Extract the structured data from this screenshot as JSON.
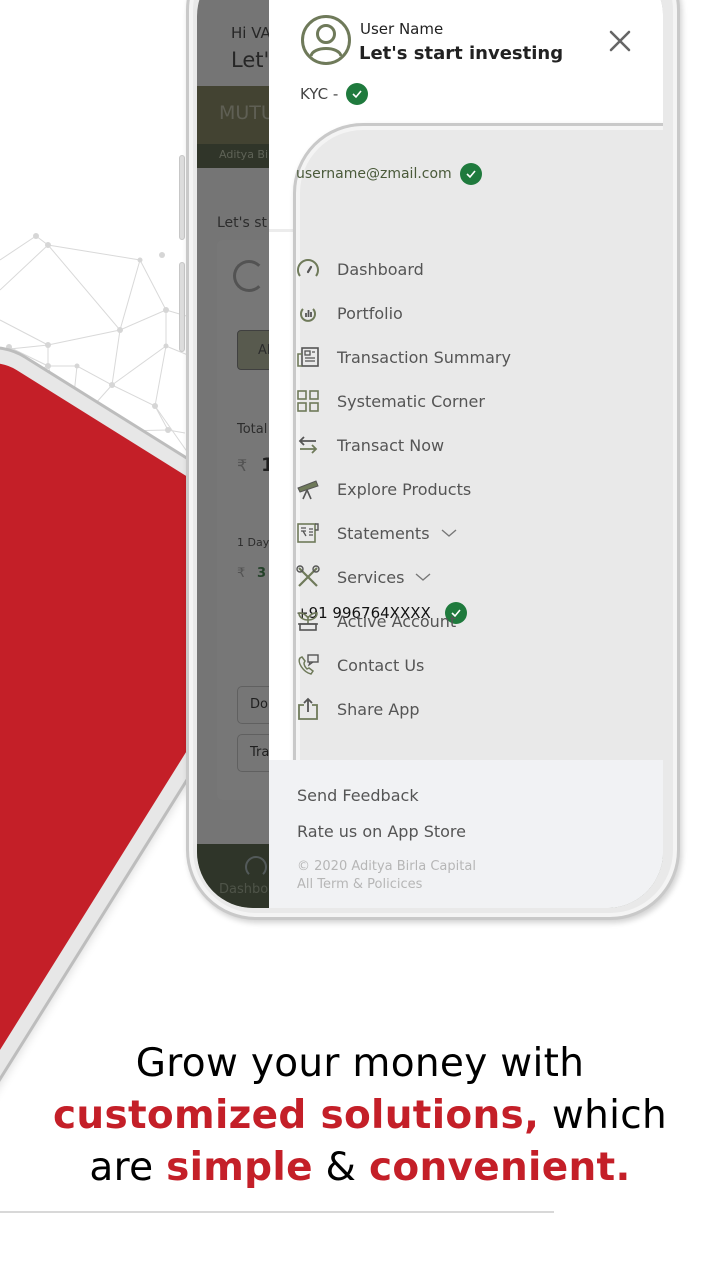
{
  "colors": {
    "brand_red": "#c41f28",
    "verified_green": "#1f7a3d",
    "icon_olive": "#6f7a5a",
    "dark_olive": "#3b4a2c"
  },
  "background_app": {
    "greeting": "Hi VA",
    "subtitle": "Let'",
    "banner": "MUTU",
    "sub_banner": "Aditya Bi",
    "lets_start": "Let's st",
    "button_partial": "Al",
    "total_label": "Total",
    "rupee_symbol": "₹",
    "total_value_partial": "1",
    "one_day_label": "1 Day",
    "one_day_value_partial": "3",
    "button_do": "Do",
    "button_tr": "Tra",
    "bottom_nav_label": "Dashbo"
  },
  "drawer": {
    "user_name": "User Name",
    "tagline": "Let's start investing",
    "kyc_label": "KYC -",
    "phone": "+91 996764XXXX",
    "email": "username@zmail.com",
    "close_icon": "close-icon",
    "menu": [
      {
        "label": "Dashboard",
        "icon": "speedometer-icon"
      },
      {
        "label": "Portfolio",
        "icon": "portfolio-chart-icon"
      },
      {
        "label": "Transaction Summary",
        "icon": "newspaper-icon"
      },
      {
        "label": "Systematic Corner",
        "icon": "grid-icon"
      },
      {
        "label": "Transact Now",
        "icon": "swap-arrows-icon"
      },
      {
        "label": "Explore Products",
        "icon": "telescope-icon"
      },
      {
        "label": "Statements",
        "icon": "statement-icon",
        "expandable": true
      },
      {
        "label": "Services",
        "icon": "tools-icon",
        "expandable": true
      },
      {
        "label": "Active Account",
        "icon": "plant-icon"
      },
      {
        "label": "Contact Us",
        "icon": "phone-chat-icon"
      },
      {
        "label": "Share App",
        "icon": "share-icon"
      }
    ],
    "footer": {
      "send_feedback": "Send Feedback",
      "rate_us": "Rate us on App Store",
      "copyright_line1": "© 2020 Aditya Birla Capital",
      "copyright_line2": "All Term & Policices"
    }
  },
  "headline": {
    "line1": "Grow your money with",
    "line2_red": "customized solutions,",
    "line2_black": " which",
    "line3_black1": "are ",
    "line3_red1": "simple",
    "line3_black2": " & ",
    "line3_red2": "convenient."
  }
}
